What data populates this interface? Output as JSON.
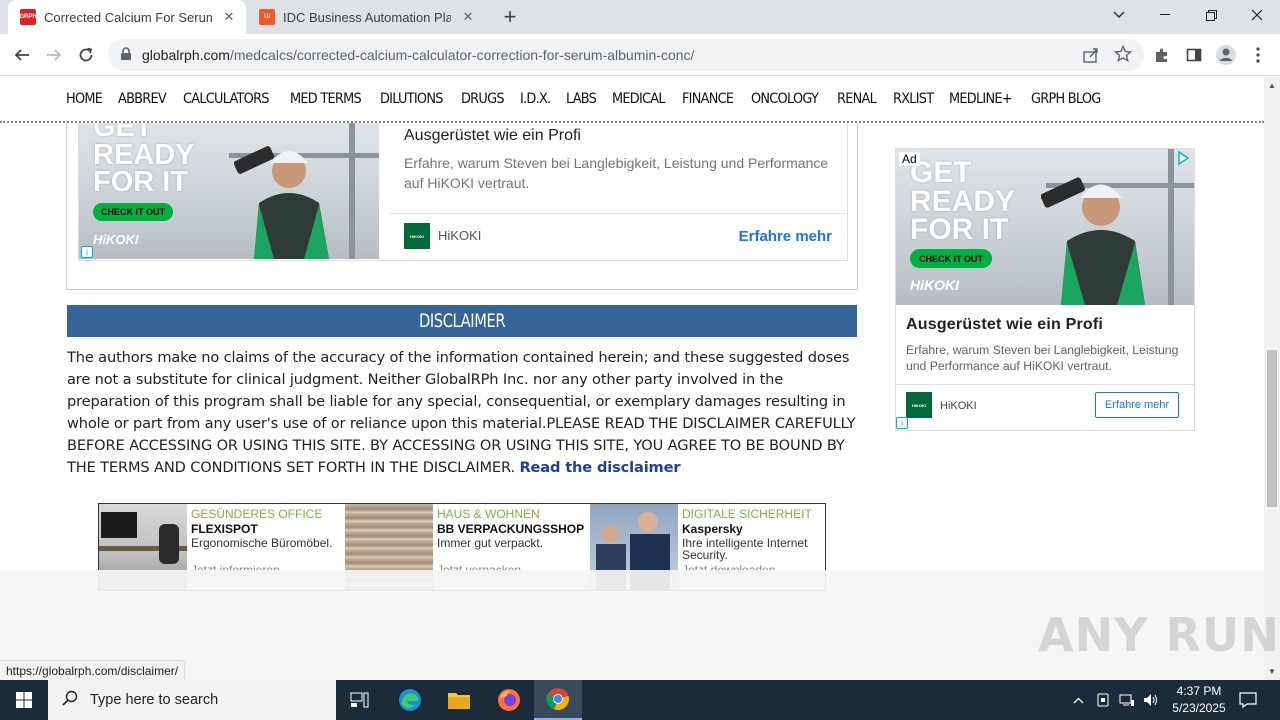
{
  "browser": {
    "tabs": [
      {
        "title": "Corrected Calcium For Serum Albumin",
        "favicon_text": "GRPH",
        "favicon_color": "#e02020",
        "active": true
      },
      {
        "title": "IDC Business Automation Platform",
        "favicon_text": "Ui",
        "favicon_color": "#f05a28",
        "active": false
      }
    ],
    "url_domain": "globalrph.com",
    "url_path": "/medcalcs/corrected-calcium-calculator-correction-for-serum-albumin-conc/"
  },
  "site_nav": {
    "items": [
      "HOME",
      "ABBREV",
      "CALCULATORS",
      "MED TERMS",
      "DILUTIONS",
      "DRUGS",
      "I.D.X.",
      "LABS",
      "MEDICAL",
      "FINANCE",
      "ONCOLOGY",
      "RENAL",
      "RXLIST",
      "MEDLINE+",
      "GRPH BLOG"
    ]
  },
  "ad_banner": {
    "image_lines": [
      "GET",
      "READY",
      "FOR IT"
    ],
    "image_cta": "CHECK IT OUT",
    "image_logo": "HiKOKI",
    "headline": "Ausgerüstet wie ein Profi",
    "description": "Erfahre, warum Steven bei Langlebigkeit, Leistung und Performance auf HiKOKI vertraut.",
    "brand": "HiKOKI",
    "cta": "Erfahre mehr"
  },
  "disclaimer": {
    "heading": "DISCLAIMER",
    "body": "The authors make no claims of the accuracy of the information contained herein; and these suggested doses are not a substitute for clinical judgment. Neither GlobalRPh Inc. nor any other party involved in the preparation of this program shall be liable for any special, consequential, or exemplary damages resulting in whole or part from any user's use of or reliance upon this material.PLEASE READ THE DISCLAIMER CAREFULLY BEFORE ACCESSING OR USING THIS SITE. BY ACCESSING OR USING THIS SITE, YOU AGREE TO BE BOUND BY THE TERMS AND CONDITIONS SET FORTH IN THE DISCLAIMER. ",
    "link": "Read the disclaimer"
  },
  "native_ads": [
    {
      "category": "GESÜNDERES OFFICE",
      "name": "FLEXISPOT",
      "desc": "Ergonomische Büromöbel.",
      "action": "Jetzt informieren"
    },
    {
      "category": "HAUS & WOHNEN",
      "name": "BB VERPACKUNGSSHOP",
      "desc": "Immer gut verpackt.",
      "action": "Jetzt verpacken"
    },
    {
      "category": "DIGITALE SICHERHEIT",
      "name": "Kaspersky",
      "desc": "Ihre intelligente Internet Security.",
      "action": "Jetzt downloaden"
    }
  ],
  "side_ad": {
    "label": "Ad",
    "image_lines": [
      "GET",
      "READY",
      "FOR IT"
    ],
    "image_cta": "CHECK IT OUT",
    "image_logo": "HiKOKI",
    "headline": "Ausgerüstet wie ein Profi",
    "description": "Erfahre, warum Steven bei Langlebigkeit, Leistung und Performance auf HiKOKI vertraut.",
    "brand": "HiKOKI",
    "cta": "Erfahre mehr"
  },
  "status_url": "https://globalrph.com/disclaimer/",
  "watermark": "ANY RUN",
  "taskbar": {
    "search_placeholder": "Type here to search",
    "time": "4:37 PM",
    "date": "5/23/2025"
  },
  "colors": {
    "disclaimer_header": "#356498",
    "link": "#1f3f9a",
    "ad_cta": "#1a73e8",
    "hikoki_green": "#00b140",
    "taskbar": "#1c2b3a"
  }
}
